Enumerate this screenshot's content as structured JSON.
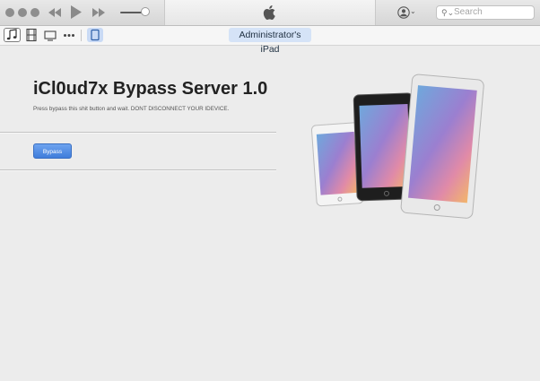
{
  "window": {
    "apple_logo": "apple-logo-icon"
  },
  "search": {
    "placeholder": "Search",
    "icon": "search-icon"
  },
  "toolbar": {
    "items": [
      "music-icon",
      "film-icon",
      "tv-icon",
      "more-icon",
      "ipad-device-icon"
    ],
    "device_name": "Administrator's iPad"
  },
  "main": {
    "title": "iCl0ud7x Bypass Server 1.0",
    "subtitle": "Press bypass this shit button and wait. DONT DISCONNECT YOUR IDEVICE.",
    "bypass_label": "Bypass"
  },
  "colors": {
    "accent": "#4a86e2",
    "pill": "#d5e3f7"
  }
}
